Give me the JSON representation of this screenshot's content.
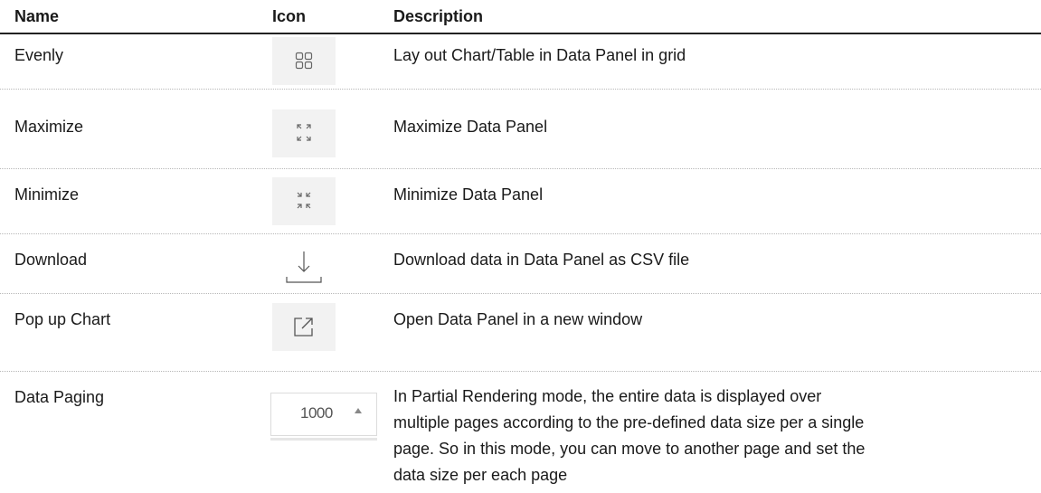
{
  "headers": {
    "name": "Name",
    "icon": "Icon",
    "description": "Description"
  },
  "rows": [
    {
      "name": "Evenly",
      "icon": "grid-icon",
      "description": "Lay out Chart/Table in Data Panel in grid"
    },
    {
      "name": "Maximize",
      "icon": "maximize-icon",
      "description": "Maximize Data Panel"
    },
    {
      "name": "Minimize",
      "icon": "minimize-icon",
      "description": "Minimize Data Panel"
    },
    {
      "name": "Download",
      "icon": "download-icon",
      "description": "Download data in Data Panel as CSV file"
    },
    {
      "name": "Pop up Chart",
      "icon": "popup-icon",
      "description": "Open Data Panel in a new window"
    },
    {
      "name": "Data Paging",
      "icon": "paging-stepper",
      "paging_value": "1000",
      "description_lines": [
        "In Partial Rendering mode, the entire data is displayed over",
        "multiple pages according to the pre-defined data size per a single",
        "page. So in this mode, you can move to another page and set the",
        "data size per each page"
      ]
    }
  ]
}
